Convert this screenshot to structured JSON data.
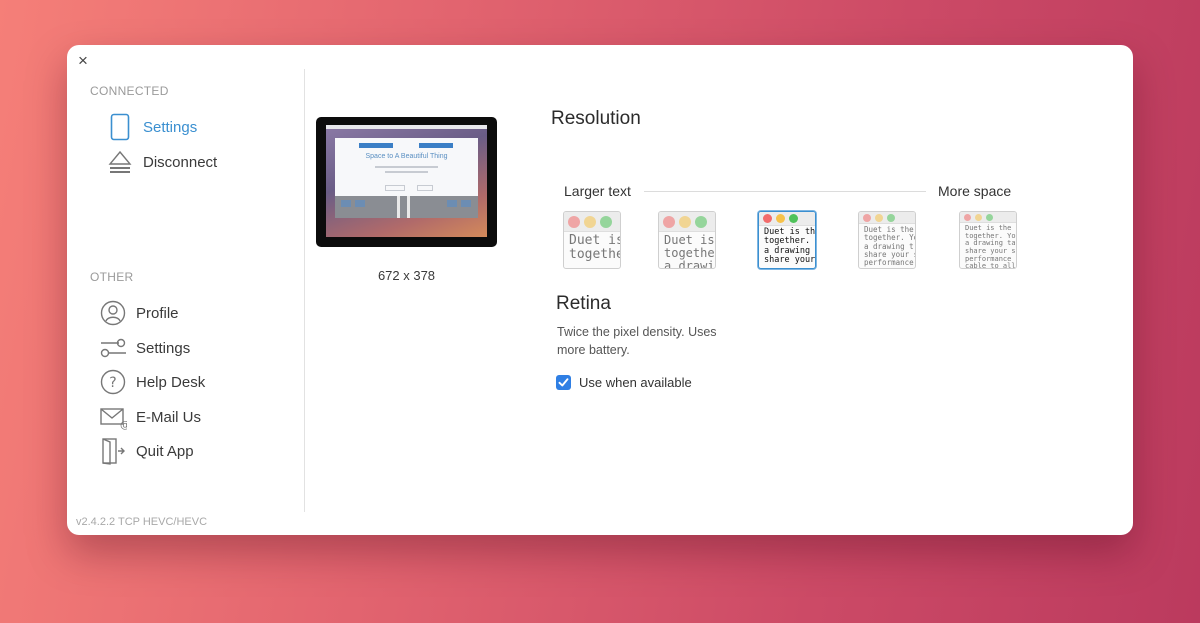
{
  "window": {
    "close_label": "×"
  },
  "sidebar": {
    "connected_label": "CONNECTED",
    "connected_items": [
      {
        "label": "Settings",
        "icon": "tablet-icon",
        "active": true
      },
      {
        "label": "Disconnect",
        "icon": "eject-icon",
        "active": false
      }
    ],
    "other_label": "OTHER",
    "other_items": [
      {
        "label": "Profile",
        "icon": "user-icon"
      },
      {
        "label": "Settings",
        "icon": "sliders-icon"
      },
      {
        "label": "Help Desk",
        "icon": "help-icon"
      },
      {
        "label": "E-Mail Us",
        "icon": "mail-icon"
      },
      {
        "label": "Quit App",
        "icon": "exit-door-icon"
      }
    ],
    "version": "v2.4.2.2 TCP HEVC/HEVC"
  },
  "preview": {
    "caption": "672 x 378",
    "screen_heading": "Space to A Beautiful Thing"
  },
  "resolution": {
    "title": "Resolution",
    "larger_label": "Larger text",
    "more_label": "More space",
    "options": [
      {
        "sample": "Duet is\ntogethe",
        "selected": false
      },
      {
        "sample": "Duet is\ntogethe\na drawi",
        "selected": false
      },
      {
        "sample": "Duet is th\ntogether.\na drawing\nshare your",
        "selected": true
      },
      {
        "sample": "Duet is the\ntogether. Yo\na drawing t\nshare your s\nperformance",
        "selected": false
      },
      {
        "sample": "Duet is the be\ntogether. You\na drawing tab\nshare your sc\nperformance s\ncable to allo",
        "selected": false
      }
    ]
  },
  "retina": {
    "title": "Retina",
    "description": "Twice the pixel density. Uses more battery.",
    "checkbox_label": "Use when available",
    "checked": true
  },
  "colors": {
    "accent": "#3a8fd0",
    "checkbox": "#2f7fe4",
    "traffic_red": "#f26b6b",
    "traffic_yellow": "#f6c24a",
    "traffic_green": "#4fc25a"
  }
}
